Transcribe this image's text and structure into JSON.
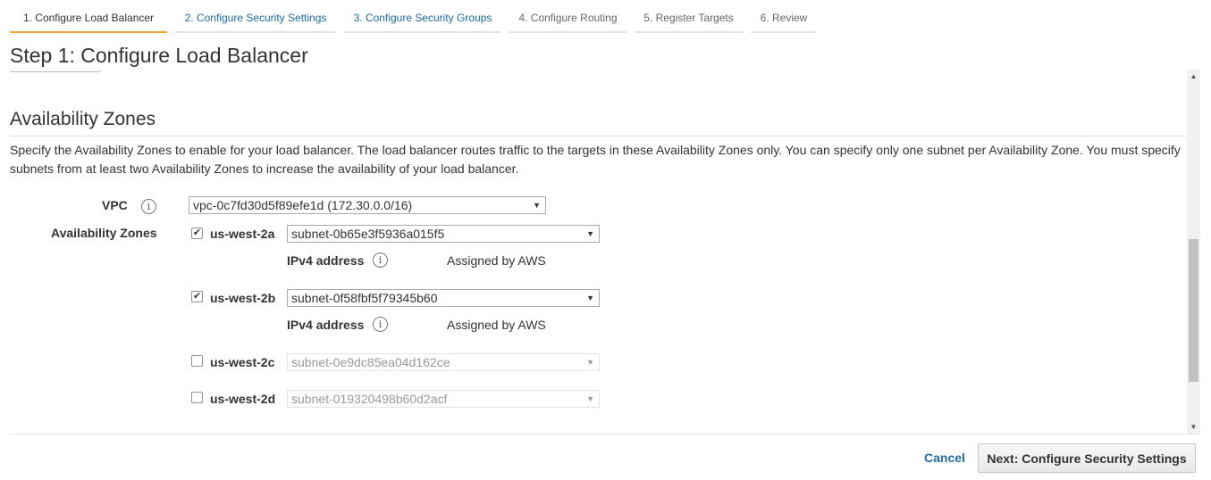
{
  "tabs": [
    {
      "label": "1. Configure Load Balancer",
      "state": "active"
    },
    {
      "label": "2. Configure Security Settings",
      "state": "link"
    },
    {
      "label": "3. Configure Security Groups",
      "state": "link"
    },
    {
      "label": "4. Configure Routing",
      "state": "plain"
    },
    {
      "label": "5. Register Targets",
      "state": "plain"
    },
    {
      "label": "6. Review",
      "state": "plain"
    }
  ],
  "page": {
    "title": "Step 1: Configure Load Balancer"
  },
  "availability": {
    "title": "Availability Zones",
    "description": "Specify the Availability Zones to enable for your load balancer. The load balancer routes traffic to the targets in these Availability Zones only. You can specify only one subnet per Availability Zone. You must specify subnets from at least two Availability Zones to increase the availability of your load balancer.",
    "vpc_label": "VPC",
    "vpc_value": "vpc-0c7fd30d5f89efe1d (172.30.0.0/16)",
    "zones_label": "Availability Zones",
    "ipv4_label": "IPv4 address",
    "ipv4_value": "Assigned by AWS",
    "zones": [
      {
        "name": "us-west-2a",
        "checked": true,
        "subnet": "subnet-0b65e3f5936a015f5"
      },
      {
        "name": "us-west-2b",
        "checked": true,
        "subnet": "subnet-0f58fbf5f79345b60"
      },
      {
        "name": "us-west-2c",
        "checked": false,
        "subnet": "subnet-0e9dc85ea04d162ce"
      },
      {
        "name": "us-west-2d",
        "checked": false,
        "subnet": "subnet-019320498b60d2acf"
      }
    ]
  },
  "icons": {
    "info": "info-icon",
    "checkmark": "check-icon",
    "dropdown": "caret-down-icon"
  },
  "footer": {
    "cancel_label": "Cancel",
    "next_label": "Next: Configure Security Settings"
  },
  "colors": {
    "active_tab": "#f0a238",
    "link": "#1c6aa4"
  }
}
